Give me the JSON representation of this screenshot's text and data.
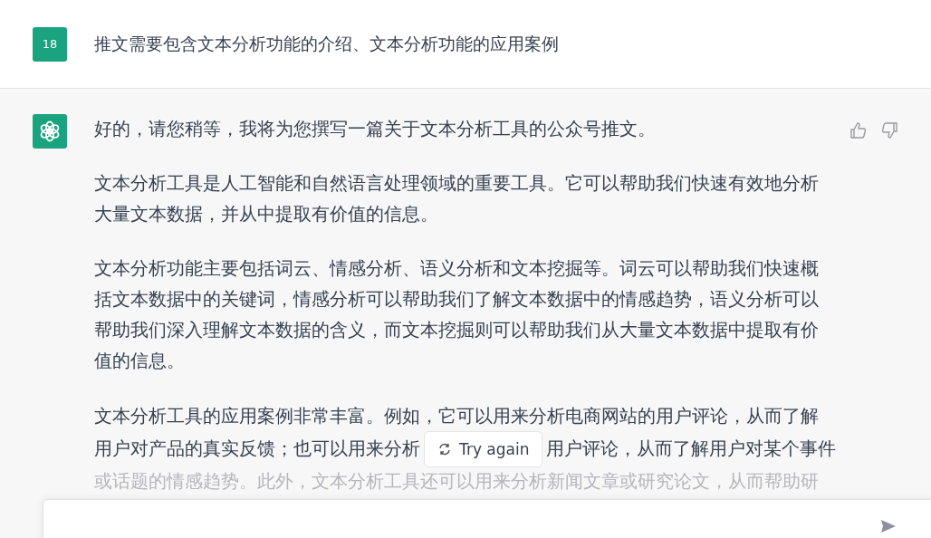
{
  "user_message": {
    "avatar_text": "18",
    "text": "推文需要包含文本分析功能的介绍、文本分析功能的应用案例"
  },
  "assistant_message": {
    "paragraphs": [
      "好的，请您稍等，我将为您撰写一篇关于文本分析工具的公众号推文。",
      "文本分析工具是人工智能和自然语言处理领域的重要工具。它可以帮助我们快速有效地分析大量文本数据，并从中提取有价值的信息。",
      "文本分析功能主要包括词云、情感分析、语义分析和文本挖掘等。词云可以帮助我们快速概括文本数据中的关键词，情感分析可以帮助我们了解文本数据中的情感趋势，语义分析可以帮助我们深入理解文本数据的含义，而文本挖掘则可以帮助我们从大量文本数据中提取有价值的信息。"
    ],
    "last_paragraph_lines": [
      {
        "segments": [
          "文本分析工具的应用案例非常丰富。例如，它可以用来分析电商网站的用户评论，从而了解"
        ]
      },
      {
        "segments": [
          "用户对产品的真实反馈；也可以用来分析",
          "用户评论，从而了解用户对某个事件"
        ]
      },
      {
        "segments": [
          "或话题的情感趋势。此外，文本分析工具还可以用来分析新闻文章或研究论文，从而帮助研"
        ]
      }
    ]
  },
  "try_again_button": {
    "label": "Try again"
  }
}
